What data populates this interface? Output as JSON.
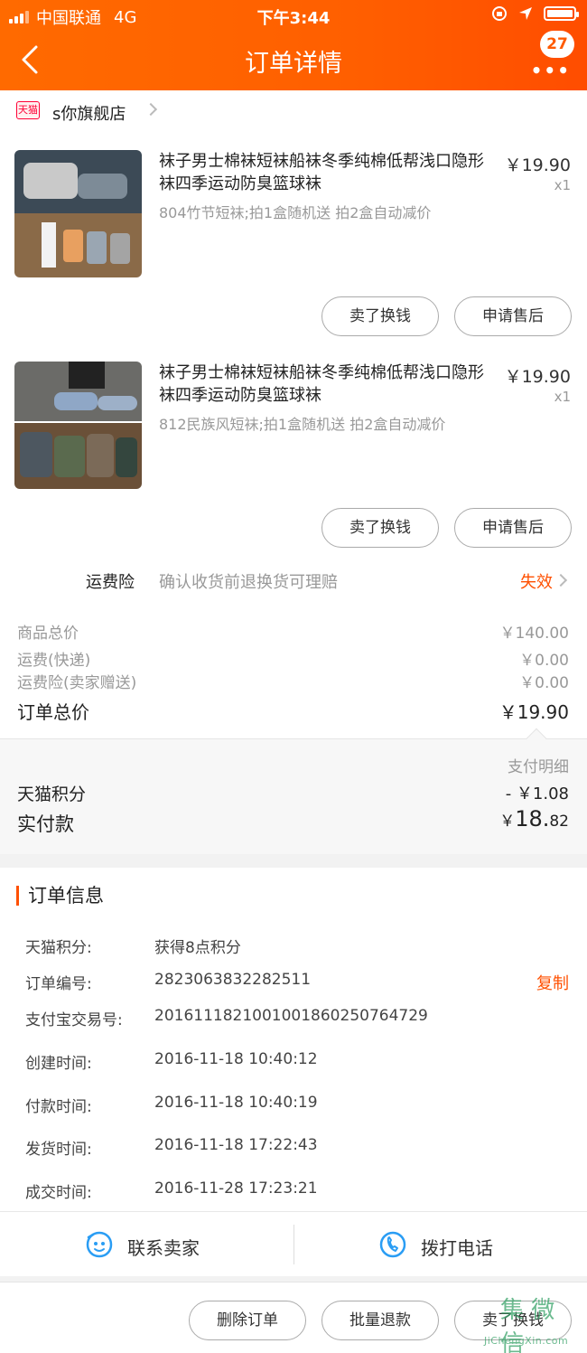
{
  "status_bar": {
    "carrier": "中国联通",
    "network": "4G",
    "time": "下午3:44"
  },
  "nav": {
    "title": "订单详情",
    "badge": "27"
  },
  "shop": {
    "tag": "天猫",
    "name": "s你旗舰店"
  },
  "items": [
    {
      "title": "袜子男士棉袜短袜船袜冬季纯棉低帮浅口隐形袜四季运动防臭篮球袜",
      "sku": "804竹节短袜;拍1盒随机送 拍2盒自动减价",
      "price": "￥19.90",
      "qty": "x1",
      "btn_sell": "卖了换钱",
      "btn_after": "申请售后"
    },
    {
      "title": "袜子男士棉袜短袜船袜冬季纯棉低帮浅口隐形袜四季运动防臭篮球袜",
      "sku": "812民族风短袜;拍1盒随机送 拍2盒自动减价",
      "price": "￥19.90",
      "qty": "x1",
      "btn_sell": "卖了换钱",
      "btn_after": "申请售后"
    }
  ],
  "insurance": {
    "label": "运费险",
    "desc": "确认收货前退换货可理赔",
    "status": "失效"
  },
  "summary": {
    "goods_label": "商品总价",
    "goods_value": "￥140.00",
    "ship_label": "运费(快递)",
    "ship_value": "￥0.00",
    "ins_label": "运费险(卖家赠送)",
    "ins_value": "￥0.00",
    "total_label": "订单总价",
    "total_value": "￥19.90"
  },
  "payment": {
    "detail_link": "支付明细",
    "points_label": "天猫积分",
    "points_value": "- ￥1.08",
    "paid_label": "实付款",
    "paid_currency": "￥",
    "paid_int": "18.",
    "paid_dec": "82"
  },
  "order_info": {
    "heading": "订单信息",
    "rows": [
      {
        "k": "天猫积分:",
        "v": "获得8点积分"
      },
      {
        "k": "订单编号:",
        "v": "2823063832282511",
        "action": "复制"
      },
      {
        "k": "支付宝交易号:",
        "v": "2016111821001001860250764729"
      },
      {
        "k": "创建时间:",
        "v": "2016-11-18 10:40:12"
      },
      {
        "k": "付款时间:",
        "v": "2016-11-18 10:40:19"
      },
      {
        "k": "发货时间:",
        "v": "2016-11-18 17:22:43"
      },
      {
        "k": "成交时间:",
        "v": "2016-11-28 17:23:21"
      }
    ]
  },
  "contact": {
    "seller": "联系卖家",
    "phone": "拨打电话"
  },
  "bottom": {
    "delete": "删除订单",
    "refund": "批量退款",
    "sell": "卖了换钱"
  },
  "watermark": {
    "main": "集 微 信",
    "url": "JiChengXin.com"
  },
  "colors": {
    "brand": "#ff5a00",
    "accent_text": "#ff5000",
    "icon_blue": "#2a9df4"
  }
}
